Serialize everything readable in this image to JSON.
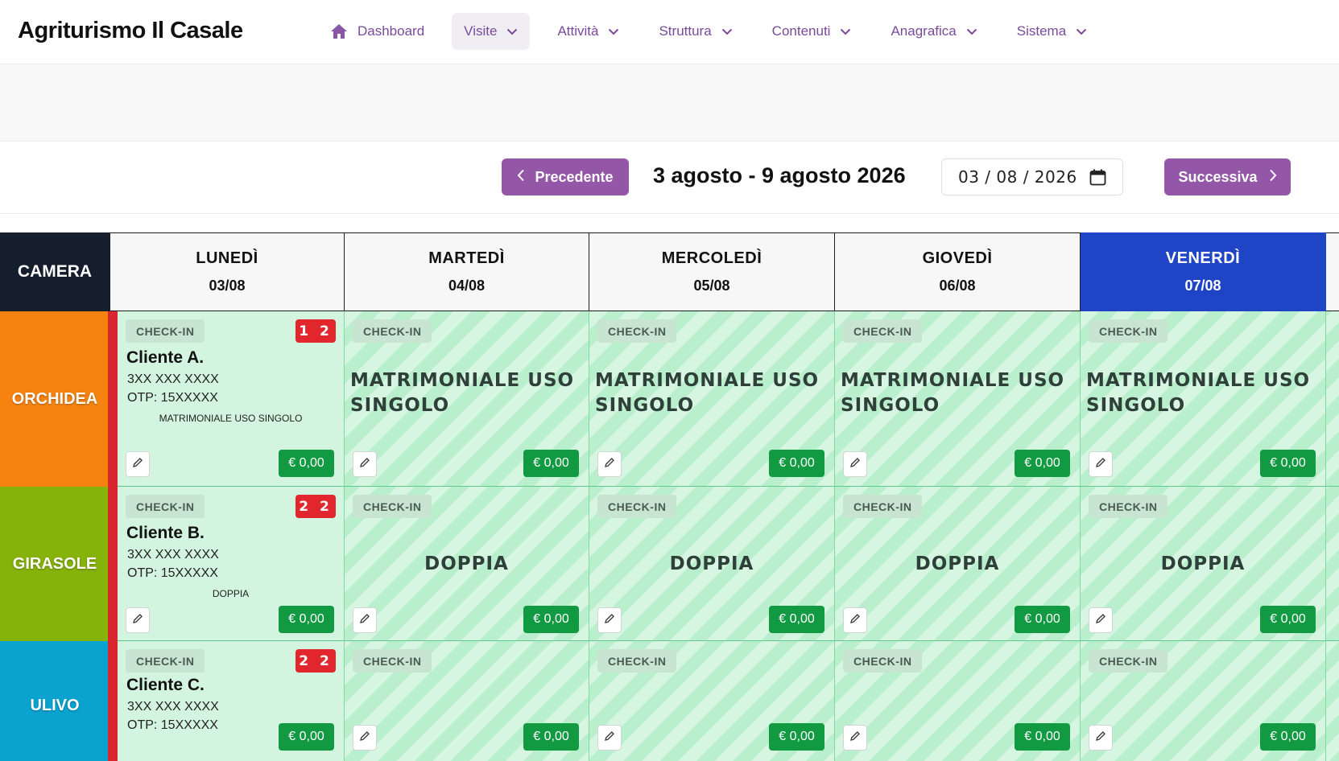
{
  "app": {
    "title": "Agriturismo Il Casale"
  },
  "nav": {
    "items": [
      {
        "label": "Dashboard",
        "icon": "home-icon"
      },
      {
        "label": "Visite",
        "icon": "chevron-down-icon"
      },
      {
        "label": "Attività",
        "icon": "chevron-down-icon"
      },
      {
        "label": "Struttura",
        "icon": "chevron-down-icon"
      },
      {
        "label": "Contenuti",
        "icon": "chevron-down-icon"
      },
      {
        "label": "Anagrafica",
        "icon": "chevron-down-icon"
      },
      {
        "label": "Sistema",
        "icon": "chevron-down-icon"
      }
    ],
    "active": "Visite",
    "accent_color": "#7a4a9a"
  },
  "toolbar": {
    "prev_label": "Precedente",
    "next_label": "Successiva",
    "range_title": "3 agosto - 9 agosto 2026",
    "date_value": "03 / 08 / 2026",
    "button_color": "#9457a8"
  },
  "calendar": {
    "camera_header": "CAMERA",
    "days": [
      {
        "name": "LUNEDÌ",
        "date": "03/08"
      },
      {
        "name": "MARTEDÌ",
        "date": "04/08"
      },
      {
        "name": "MERCOLEDÌ",
        "date": "05/08"
      },
      {
        "name": "GIOVEDÌ",
        "date": "06/08"
      },
      {
        "name": "VENERDÌ",
        "date": "07/08",
        "today": true
      }
    ],
    "today_color": "#1f44c5",
    "rooms": [
      {
        "name": "ORCHIDEA",
        "color": "#f6830f",
        "guest": {
          "name": "Cliente A.",
          "phone": "3XX XXX XXXX",
          "otp": "OTP: 15XXXXX",
          "room_type": "MATRIMONIALE USO SINGOLO",
          "counter": "1 2"
        },
        "stay_label": "MATRIMONIALE USO SINGOLO",
        "checkin_label": "CHECK-IN",
        "price": "€ 0,00"
      },
      {
        "name": "GIRASOLE",
        "color": "#86b30a",
        "guest": {
          "name": "Cliente B.",
          "phone": "3XX XXX XXXX",
          "otp": "OTP: 15XXXXX",
          "room_type": "DOPPIA",
          "counter": "2 2"
        },
        "stay_label": "DOPPIA",
        "checkin_label": "CHECK-IN",
        "price": "€ 0,00"
      },
      {
        "name": "ULIVO",
        "color": "#0aa3cf",
        "guest": {
          "name": "Cliente C.",
          "phone": "3XX XXX XXXX",
          "otp": "OTP: 15XXXXX",
          "room_type": "",
          "counter": "2 2"
        },
        "stay_label": "",
        "checkin_label": "CHECK-IN",
        "price": "€ 0,00"
      }
    ]
  }
}
